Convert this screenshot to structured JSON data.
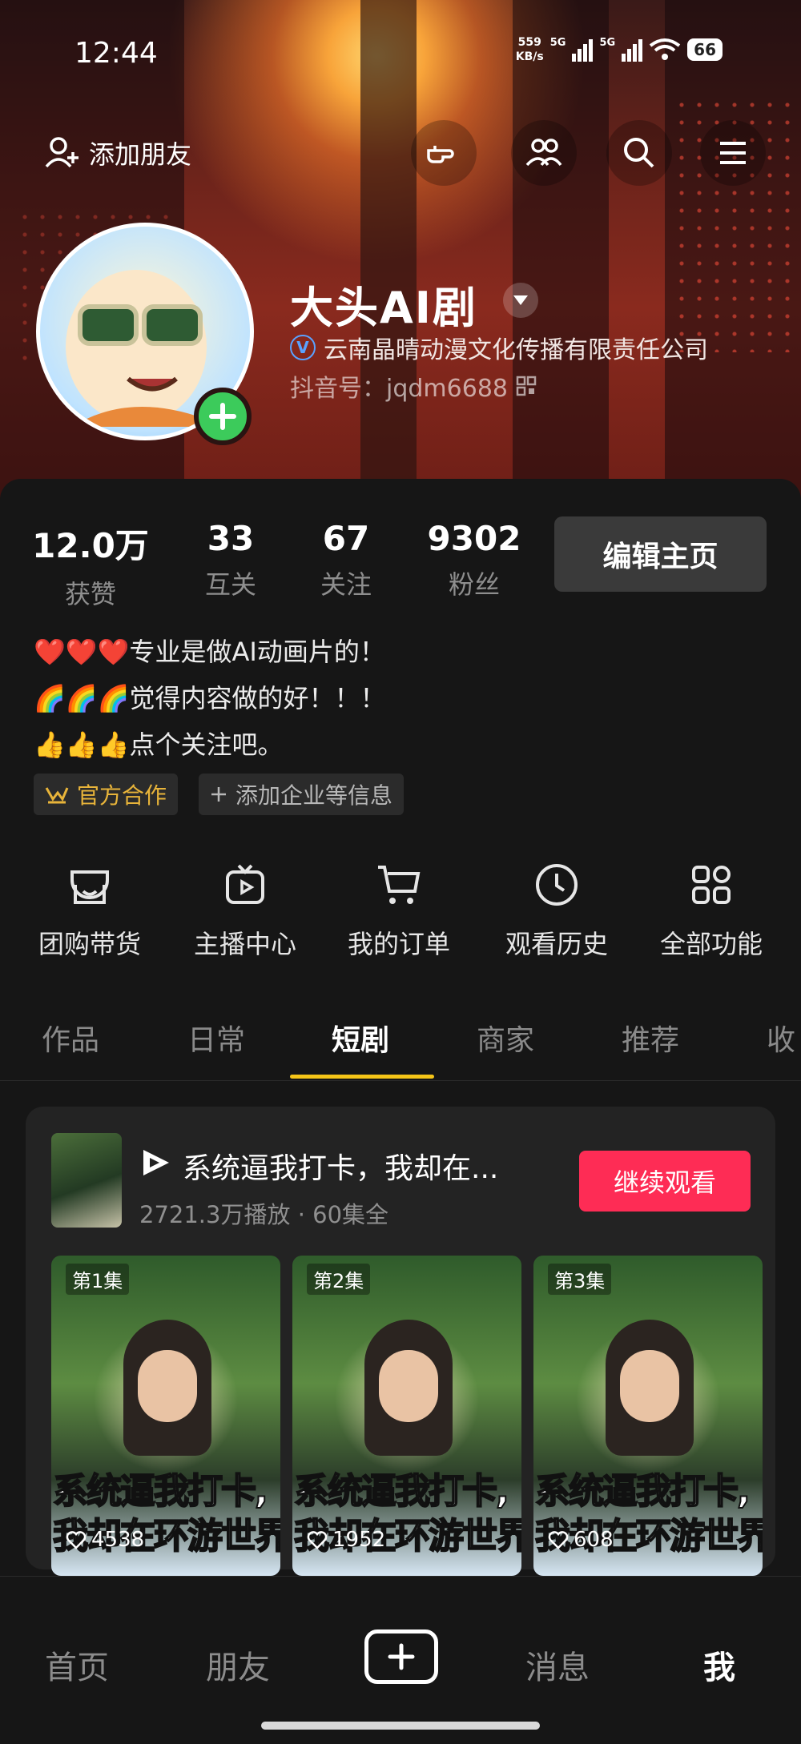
{
  "status_bar": {
    "time": "12:44",
    "net_speed_value": "559",
    "net_speed_unit": "KB/s",
    "network1": "5G",
    "network2": "5G",
    "battery": "66"
  },
  "top_nav": {
    "add_friend_label": "添加朋友",
    "icons": [
      "hand-point-icon",
      "friends-icon",
      "search-icon",
      "menu-icon"
    ]
  },
  "profile": {
    "nickname": "大头AI剧",
    "verified_org": "云南晶晴动漫文化传播有限责任公司",
    "verify_badge": "V",
    "douyin_id": "抖音号：jqdm6688"
  },
  "stats": [
    {
      "value": "12.0万",
      "label": "获赞"
    },
    {
      "value": "33",
      "label": "互关"
    },
    {
      "value": "67",
      "label": "关注"
    },
    {
      "value": "9302",
      "label": "粉丝"
    }
  ],
  "edit_button": "编辑主页",
  "bio": {
    "line1": "❤️❤️❤️专业是做AI动画片的！",
    "line2": "🌈🌈🌈觉得内容做的好！！！",
    "line3": "👍👍👍点个关注吧。"
  },
  "tags": {
    "official": "官方合作",
    "add_info": "添加企业等信息"
  },
  "functions": [
    {
      "label": "团购带货",
      "icon": "shop-icon"
    },
    {
      "label": "主播中心",
      "icon": "tv-play-icon"
    },
    {
      "label": "我的订单",
      "icon": "cart-icon"
    },
    {
      "label": "观看历史",
      "icon": "clock-icon"
    },
    {
      "label": "全部功能",
      "icon": "grid-icon"
    }
  ],
  "tabs": [
    "作品",
    "日常",
    "短剧",
    "商家",
    "推荐",
    "收"
  ],
  "active_tab": "短剧",
  "drama": {
    "title": "系统逼我打卡，我却在...",
    "meta": "2721.3万播放 · 60集全",
    "continue_label": "继续观看",
    "cover_text_line1": "系统逼我打卡,",
    "cover_text_line2": "我却在环游世界",
    "episodes": [
      {
        "label": "第1集",
        "likes": "4538"
      },
      {
        "label": "第2集",
        "likes": "1952"
      },
      {
        "label": "第3集",
        "likes": "608"
      }
    ]
  },
  "bottom_nav": {
    "home": "首页",
    "friends": "朋友",
    "messages": "消息",
    "me": "我"
  },
  "colors": {
    "accent_red": "#fe2c55",
    "tab_underline": "#f5c518",
    "plus_green": "#3ccb5b"
  }
}
